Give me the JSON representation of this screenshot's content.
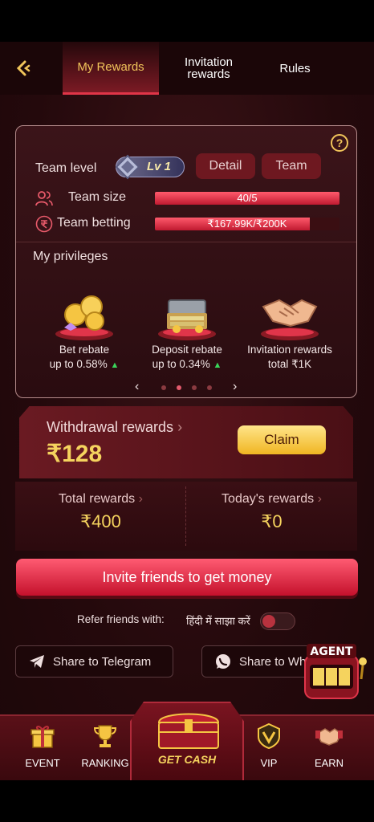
{
  "header": {
    "tabs": [
      {
        "label": "My Rewards",
        "active": true
      },
      {
        "label": "Invitation rewards",
        "active": false
      },
      {
        "label": "Rules",
        "active": false
      }
    ]
  },
  "team": {
    "level_label": "Team level",
    "level_badge": "Lv 1",
    "detail_label": "Detail",
    "team_label": "Team",
    "size_label": "Team size",
    "size_value": "40/5",
    "size_progress": 1.0,
    "betting_label": "Team betting",
    "betting_value": "₹167.99K/₹200K",
    "betting_progress": 0.84
  },
  "privileges": {
    "title": "My privileges",
    "items": [
      {
        "line1": "Bet rebate",
        "line2": "up to 0.58%",
        "trend": "up"
      },
      {
        "line1": "Deposit rebate",
        "line2": "up to 0.34%",
        "trend": "up"
      },
      {
        "line1": "Invitation rewards",
        "line2": "total ₹1K",
        "trend": ""
      }
    ],
    "page_index": 1,
    "page_count": 4
  },
  "withdrawal": {
    "label": "Withdrawal rewards",
    "chevron": "›",
    "amount": "₹128",
    "claim_label": "Claim"
  },
  "totals": {
    "total_label": "Total rewards",
    "total_value": "₹400",
    "today_label": "Today's rewards",
    "today_value": "₹0"
  },
  "invite_label": "Invite friends to get money",
  "refer": {
    "label": "Refer friends with:",
    "language": "हिंदी में साझा करें",
    "enabled": false
  },
  "share": {
    "telegram": "Share to Telegram",
    "whatsapp": "Share to Wh"
  },
  "agent_label": "AGENT",
  "nav": {
    "event": "EVENT",
    "ranking": "RANKING",
    "get_cash": "GET CASH",
    "vip": "VIP",
    "earn": "EARN"
  },
  "colors": {
    "accent_gold": "#f5d35e",
    "primary_red": "#c4112c",
    "background": "#24090c"
  }
}
